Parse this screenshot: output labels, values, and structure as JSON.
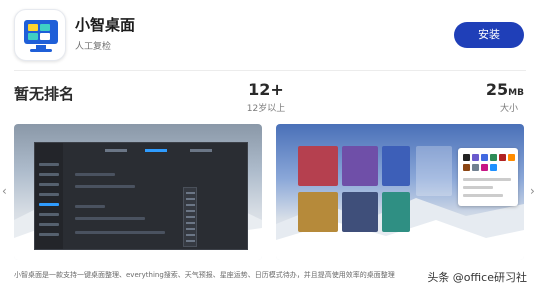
{
  "app": {
    "title": "小智桌面",
    "subtitle": "人工复检",
    "install_label": "安装"
  },
  "stats": {
    "rank": "暂无排名",
    "age_value": "12+",
    "age_label": "12岁以上",
    "size_value": "25",
    "size_unit": "MB",
    "size_label": "大小"
  },
  "description": "小智桌面是一款支持一键桌面整理、everything搜索、天气预报、星座运势、日历模式待办，并且提高使用效率的桌面整理",
  "watermark": "头条 @office研习社",
  "colors": {
    "install_button": "#1f3fb8",
    "icon_blue": "#1f5fd8"
  }
}
